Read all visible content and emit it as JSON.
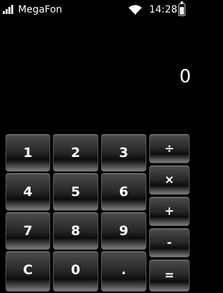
{
  "status_bar": {
    "carrier": "MegaFon",
    "time": "14:28",
    "signal_icon": "signal-bars-icon",
    "wifi_icon": "wifi-icon",
    "battery_icon": "battery-icon"
  },
  "display": {
    "value": "0"
  },
  "keypad": {
    "digits": [
      "1",
      "2",
      "3",
      "4",
      "5",
      "6",
      "7",
      "8",
      "9",
      "C",
      "0",
      "."
    ],
    "operators": [
      "÷",
      "×",
      "+",
      "-",
      "="
    ]
  },
  "colors": {
    "background": "#000000",
    "text": "#ffffff"
  }
}
